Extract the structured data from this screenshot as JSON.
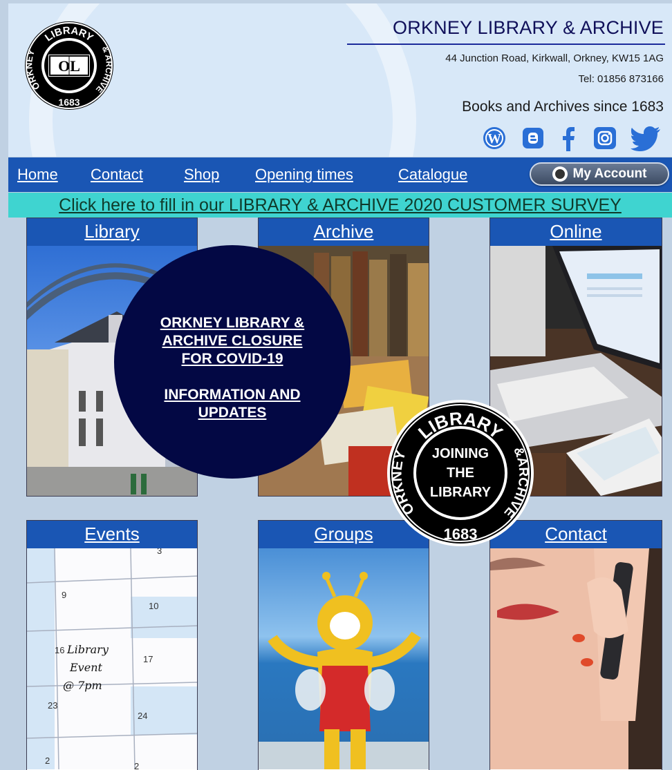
{
  "header": {
    "title": "ORKNEY LIBRARY & ARCHIVE",
    "address": "44 Junction Road, Kirkwall, Orkney, KW15 1AG",
    "tel": "Tel: 01856 873166",
    "tagline": "Books and Archives since 1683",
    "logo": {
      "top": "LIBRARY",
      "left": "ORKNEY",
      "right": "& ARCHIVE",
      "year": "1683",
      "monogram": "OL"
    },
    "social": [
      "wordpress-icon",
      "blogger-icon",
      "facebook-icon",
      "instagram-icon",
      "twitter-icon"
    ]
  },
  "nav": {
    "links": [
      "Home",
      "Contact",
      "Shop",
      "Opening times",
      "Catalogue"
    ],
    "account_label": "My Account"
  },
  "survey": {
    "label": "Click here to fill in our LIBRARY & ARCHIVE 2020 CUSTOMER SURVEY"
  },
  "tiles": {
    "library": "Library",
    "archive": "Archive",
    "online": "Online",
    "events": "Events",
    "groups": "Groups",
    "contact": "Contact"
  },
  "calendar": {
    "numbers": [
      "3",
      "9",
      "10",
      "16",
      "17",
      "23",
      "24",
      "2",
      "2"
    ],
    "note": [
      "Library",
      "Event",
      "@ 7pm"
    ]
  },
  "covid": {
    "line1": "ORKNEY LIBRARY &",
    "line2": "ARCHIVE CLOSURE",
    "line3": "FOR COVID-19",
    "line4": "INFORMATION AND",
    "line5": "UPDATES"
  },
  "joining": {
    "top": "LIBRARY",
    "left": "ORKNEY",
    "right": "&ARCHIVE",
    "year": "1683",
    "line1": "JOINING",
    "line2": "THE",
    "line3": "LIBRARY"
  },
  "colors": {
    "nav": "#1a56b4",
    "survey": "#3fd4d0",
    "page": "#c0d1e3",
    "covid": "#030844"
  }
}
